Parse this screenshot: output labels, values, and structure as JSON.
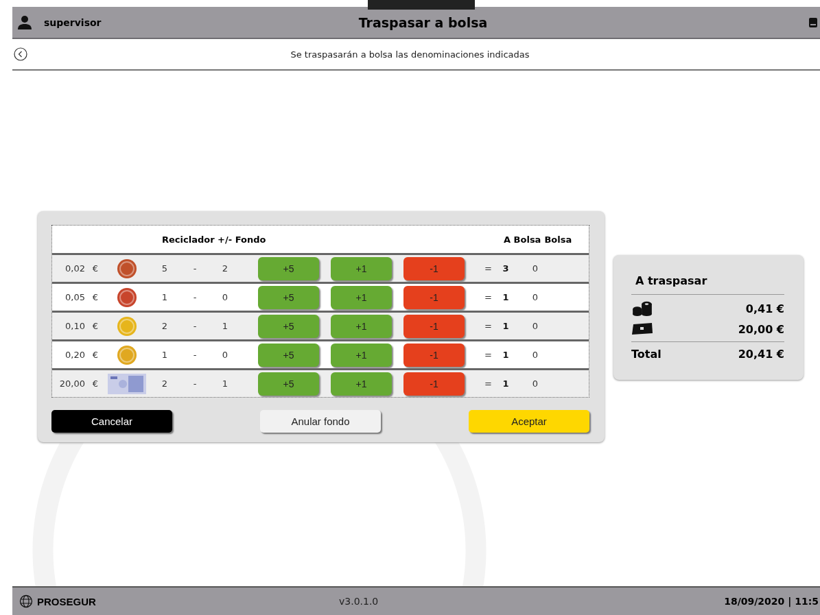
{
  "header": {
    "user": "supervisor",
    "title": "Traspasar a bolsa"
  },
  "subheader": {
    "message": "Se traspasarán a bolsa las denominaciones indicadas"
  },
  "table": {
    "columns": [
      "Reciclador +/- Fondo",
      "A Bolsa",
      "Bolsa"
    ],
    "rows": [
      {
        "denomination": "0,02",
        "currency": "€",
        "kind": "coin",
        "color": "#c0502a",
        "reciclador": "5",
        "minus": "-",
        "fondo": "2",
        "plus5": "+5",
        "plus1": "+1",
        "minus1": "-1",
        "equals": "=",
        "a_bolsa": "3",
        "bolsa": "0"
      },
      {
        "denomination": "0,05",
        "currency": "€",
        "kind": "coin",
        "color": "#c8452c",
        "reciclador": "1",
        "minus": "-",
        "fondo": "0",
        "plus5": "+5",
        "plus1": "+1",
        "minus1": "-1",
        "equals": "=",
        "a_bolsa": "1",
        "bolsa": "0"
      },
      {
        "denomination": "0,10",
        "currency": "€",
        "kind": "coin",
        "color": "#e6b51c",
        "reciclador": "2",
        "minus": "-",
        "fondo": "1",
        "plus5": "+5",
        "plus1": "+1",
        "minus1": "-1",
        "equals": "=",
        "a_bolsa": "1",
        "bolsa": "0"
      },
      {
        "denomination": "0,20",
        "currency": "€",
        "kind": "coin",
        "color": "#e0a820",
        "reciclador": "1",
        "minus": "-",
        "fondo": "0",
        "plus5": "+5",
        "plus1": "+1",
        "minus1": "-1",
        "equals": "=",
        "a_bolsa": "1",
        "bolsa": "0"
      },
      {
        "denomination": "20,00",
        "currency": "€",
        "kind": "note",
        "reciclador": "2",
        "minus": "-",
        "fondo": "1",
        "plus5": "+5",
        "plus1": "+1",
        "minus1": "-1",
        "equals": "=",
        "a_bolsa": "1",
        "bolsa": "0"
      }
    ]
  },
  "buttons": [
    {
      "label": "Cancelar",
      "kind": "dark"
    },
    {
      "label": "Anular fondo",
      "kind": "light"
    },
    {
      "label": "Aceptar",
      "kind": "primary"
    }
  ],
  "summary": {
    "title": "A traspasar",
    "lines": [
      {
        "kind": "coins",
        "amount": "0,41 €"
      },
      {
        "kind": "notes",
        "amount": "20,00 €"
      }
    ],
    "total_label": "Total",
    "total": "20,41 €"
  },
  "footer": {
    "brand": "PROSEGUR",
    "version": "v3.0.1.0",
    "datetime": "18/09/2020 | 11:5"
  }
}
